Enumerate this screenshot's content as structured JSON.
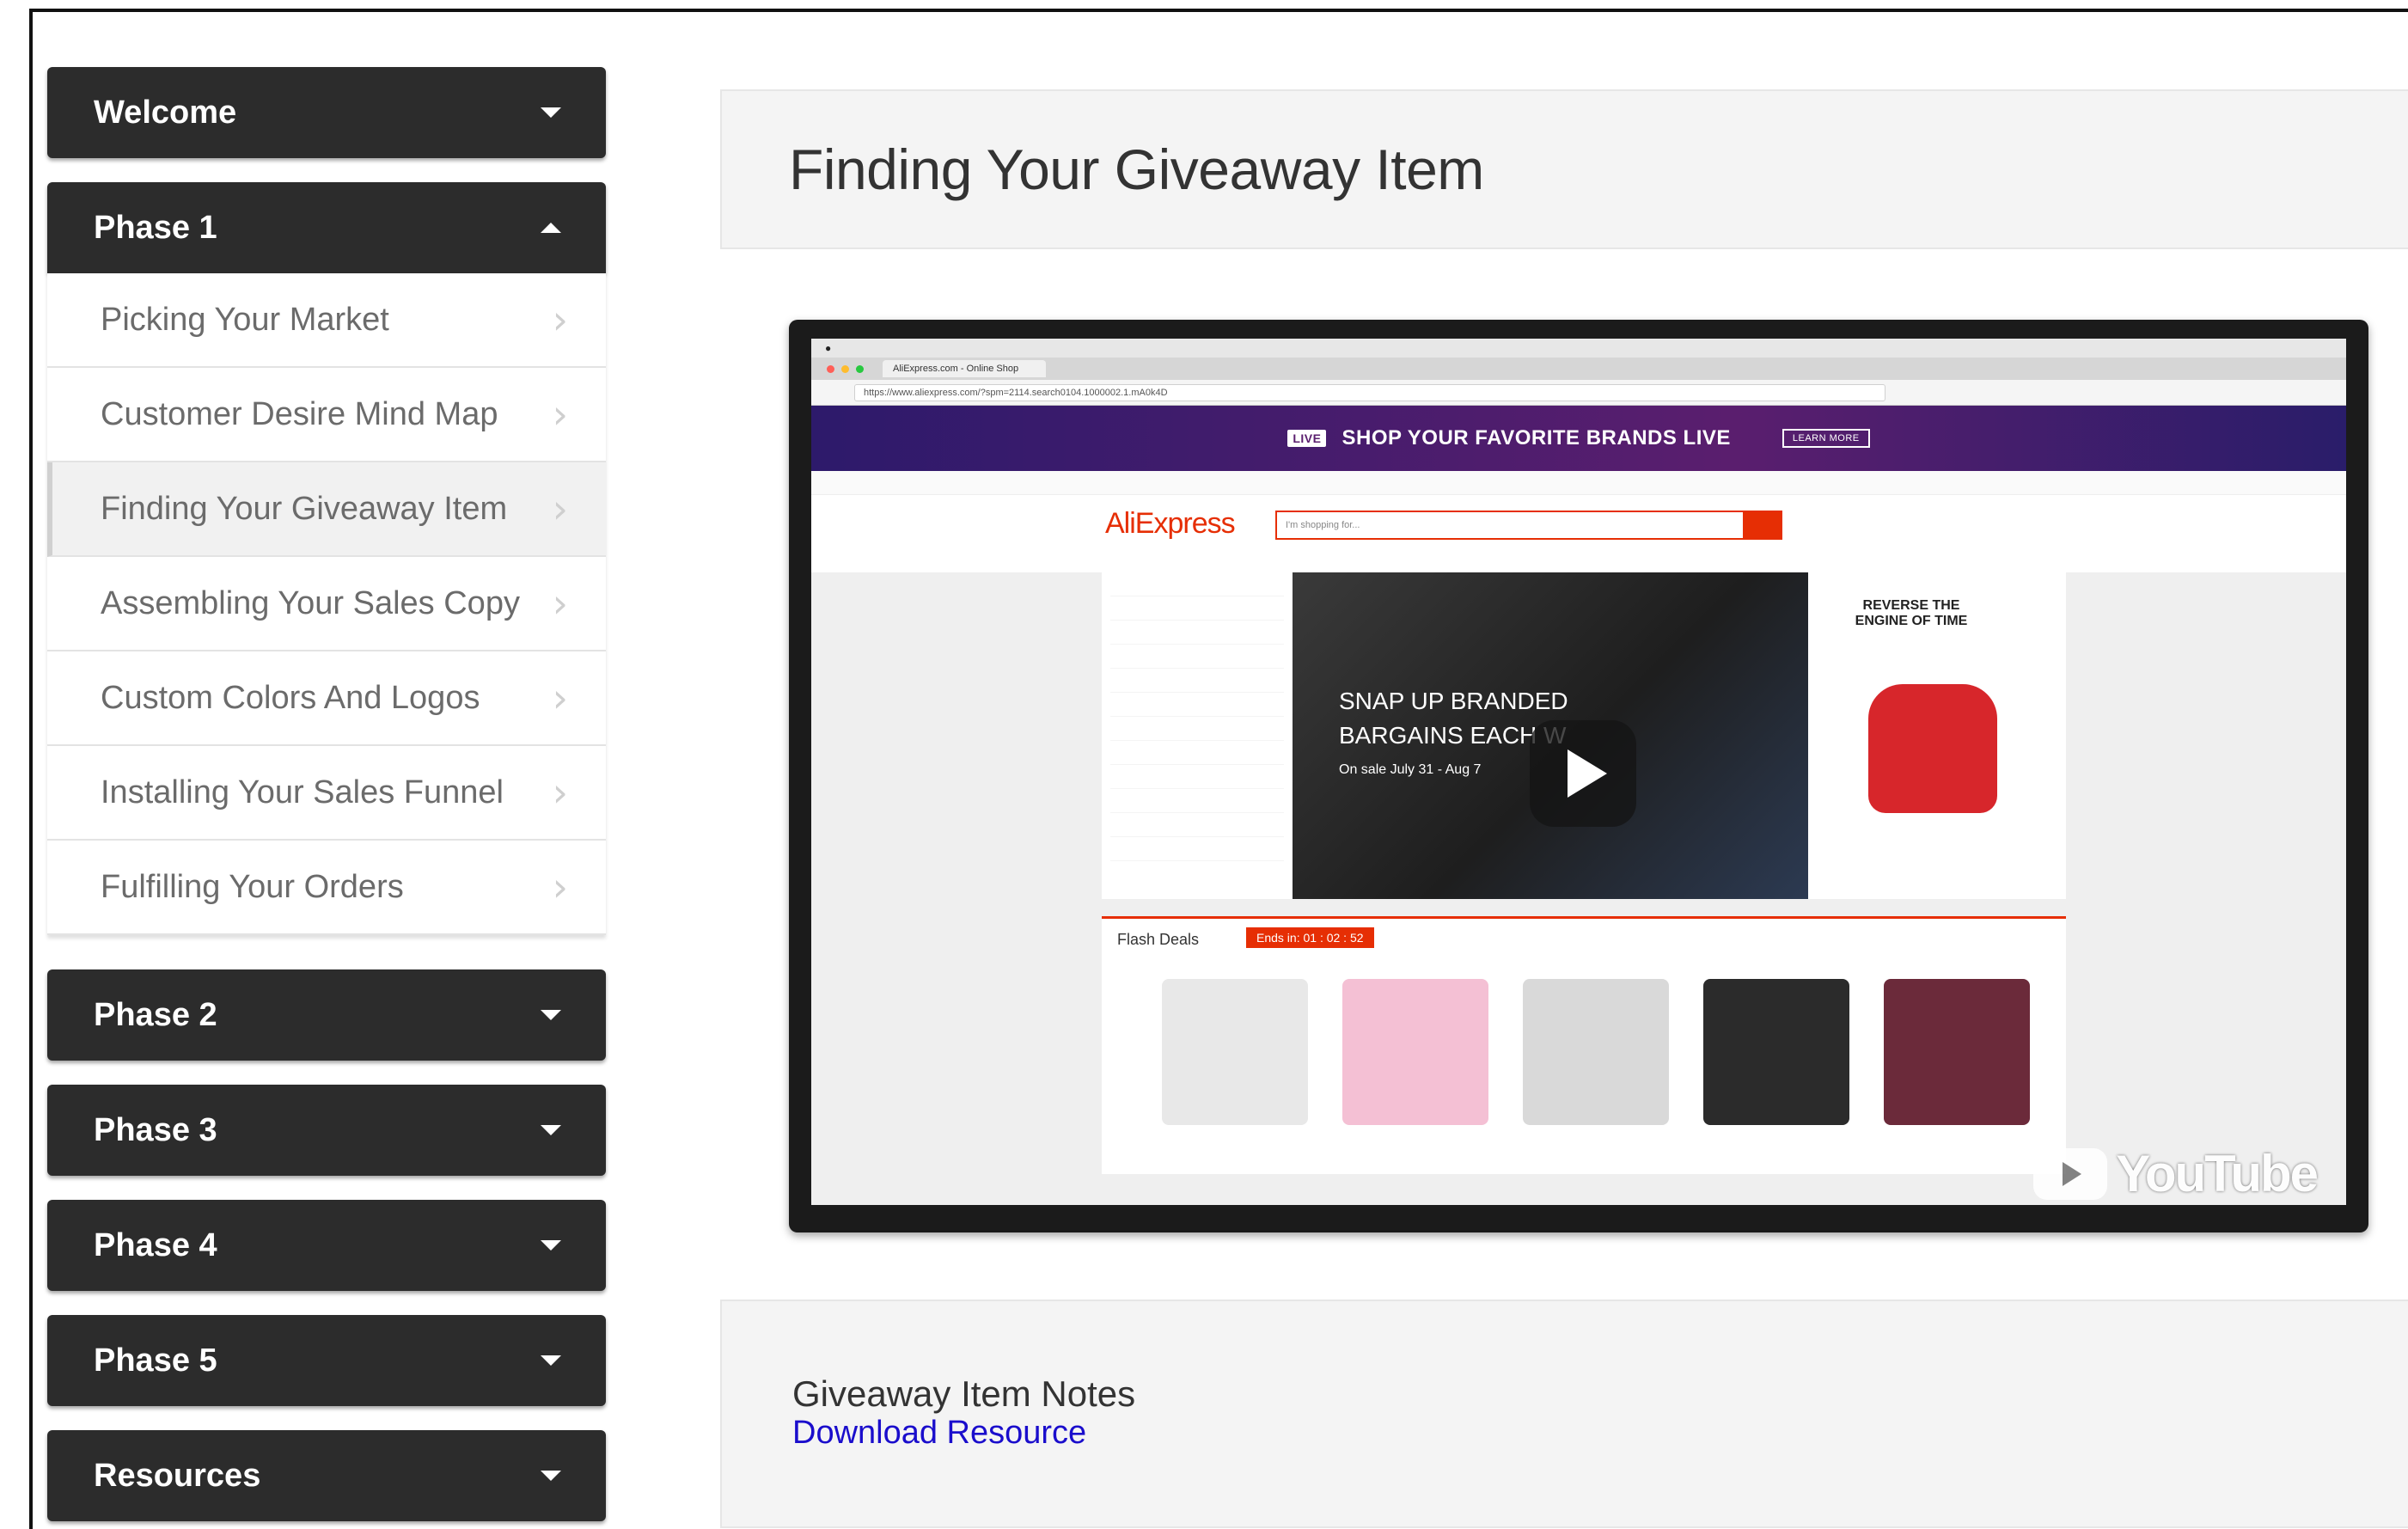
{
  "sidebar": {
    "welcome": "Welcome",
    "phase1": {
      "label": "Phase 1",
      "items": [
        "Picking Your Market",
        "Customer Desire Mind Map",
        "Finding Your Giveaway Item",
        "Assembling Your Sales Copy",
        "Custom Colors And Logos",
        "Installing Your Sales Funnel",
        "Fulfilling Your Orders"
      ],
      "active_index": 2
    },
    "phase2": "Phase 2",
    "phase3": "Phase 3",
    "phase4": "Phase 4",
    "phase5": "Phase 5",
    "resources": "Resources"
  },
  "main": {
    "title": "Finding Your Giveaway Item",
    "video": {
      "browser_tab": "AliExpress.com - Online Shop",
      "url": "https://www.aliexpress.com/?spm=2114.search0104.1000002.1.mA0k4D",
      "promo_text": "SHOP YOUR FAVORITE BRANDS LIVE",
      "promo_badge": "LIVE",
      "promo_button": "LEARN MORE",
      "site_logo": "AliExpress",
      "search_placeholder": "I'm shopping for...",
      "banner_line1": "SNAP UP BRANDED",
      "banner_line2": "BARGAINS EACH W",
      "banner_line3": "On sale July 31 - Aug 7",
      "side_ad": "REVERSE THE ENGINE OF TIME",
      "flash_title": "Flash Deals",
      "flash_timer": "Ends in: 01 : 02 : 52",
      "youtube_wordmark": "YouTube"
    },
    "notes": {
      "title": "Giveaway Item Notes",
      "link": "Download Resource"
    }
  },
  "colors": {
    "sidebar_header": "#2c2c2c",
    "link": "#1a0dcc",
    "aliexpress_red": "#e62e04"
  }
}
